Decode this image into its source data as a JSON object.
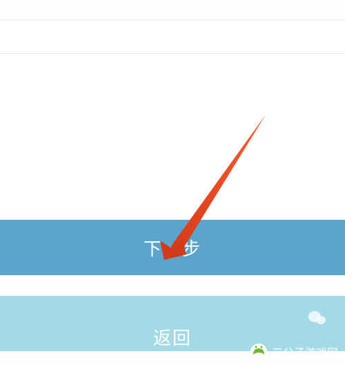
{
  "buttons": {
    "primary_label": "下一步",
    "secondary_label": "返回"
  },
  "watermark": {
    "text": "三公子游戏网"
  }
}
